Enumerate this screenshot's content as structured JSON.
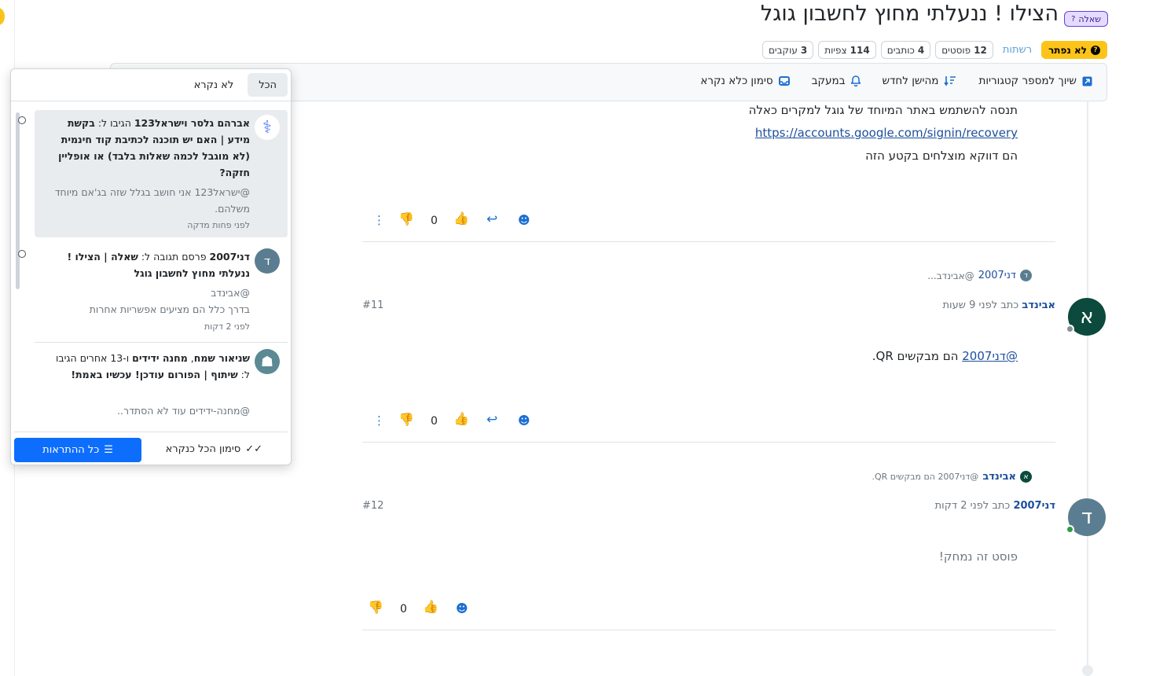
{
  "topic": {
    "title": "הצילו ! ננעלתי מחוץ לחשבון גוגל",
    "badge": "שאלה",
    "badge_icon": "?",
    "status": "לא נפתר",
    "tags_label": "רשתות",
    "stats": [
      {
        "value": "12",
        "label": "פוסטים"
      },
      {
        "value": "4",
        "label": "כותבים"
      },
      {
        "value": "114",
        "label": "צפיות"
      },
      {
        "value": "3",
        "label": "עוקבים"
      }
    ]
  },
  "toolbar": {
    "mark_unread": "סימון כלא נקרא",
    "watching": "במעקב",
    "sort": "מהישן לחדש",
    "categories": "שיוך למספר קטגוריות"
  },
  "posts": [
    {
      "lines": [
        "תנסה להשתמש באתר המיוחד של גוגל למקרים כאלה",
        "https://accounts.google.com/signin/recovery",
        "הם דווקא מוצלחים בקטע הזה"
      ],
      "votes": "0"
    },
    {
      "reply_to_name": "דני2007",
      "reply_to_initial": "ד",
      "reply_to_excerpt": "@אבינדב...",
      "author": "אבינדב",
      "author_initial": "א",
      "meta": "כתב לפני 9 שעות",
      "number": "#11",
      "mention": "@דני2007",
      "body_rest": " הם מבקשים QR.",
      "votes": "0"
    },
    {
      "reply_to_name": "אבינדב",
      "reply_to_initial": "א",
      "reply_to_excerpt": "@דני2007 הם מבקשים QR.",
      "author": "דני2007",
      "author_initial": "ד",
      "meta": "כתב לפני 2 דקות",
      "number": "#12",
      "body": "פוסט זה נמחק!",
      "votes": "0"
    }
  ],
  "notifications": {
    "tab_all": "הכל",
    "tab_unread": "לא נקרא",
    "items": [
      {
        "actors": "אברהם גלסר וישראל123",
        "verb": " הגיבו ל: ",
        "topic": "בקשת מידע | האם יש תוכנה לכתיבת קוד חינמית (לא מוגבל לכמה שאלות בלבד) או אופליין חזקה?",
        "excerpt": "@ישראל123 אני חושב בגלל שזה בג'אם מיוחד משלהם.",
        "time": "לפני פחות מדקה"
      },
      {
        "actors": "דני2007",
        "verb": " פרסם תגובה ל: ",
        "topic": "שאלה | הצילו ! ננעלתי מחוץ לחשבון גוגל",
        "excerpt_line1": "@אבינדב",
        "excerpt_line2": "בדרך כלל הם מציעים אפשריות אחרות",
        "time": "לפני 2 דקות",
        "initial": "ד"
      },
      {
        "actor1": "שניאור שמח",
        "sep": ", ",
        "actor2": "מחנה ידידים",
        "rest": " ו-13 אחרים",
        "verb": "הגיבו ל: ",
        "topic": "שיתוף | הפורום עודכן! עכשיו באמת!",
        "excerpt": "@מחנה-ידידים עוד לא הסתדר.."
      }
    ],
    "mark_all": "סימון הכל כנקרא",
    "all_notifications": "כל ההתראות"
  },
  "colors": {
    "accent": "#0d6efd",
    "warning": "#fcc419",
    "link": "#1c4f9c",
    "avatar_a": "#0b4a3c",
    "avatar_d": "#5b7d91",
    "badge_purple": "#6741d9"
  }
}
